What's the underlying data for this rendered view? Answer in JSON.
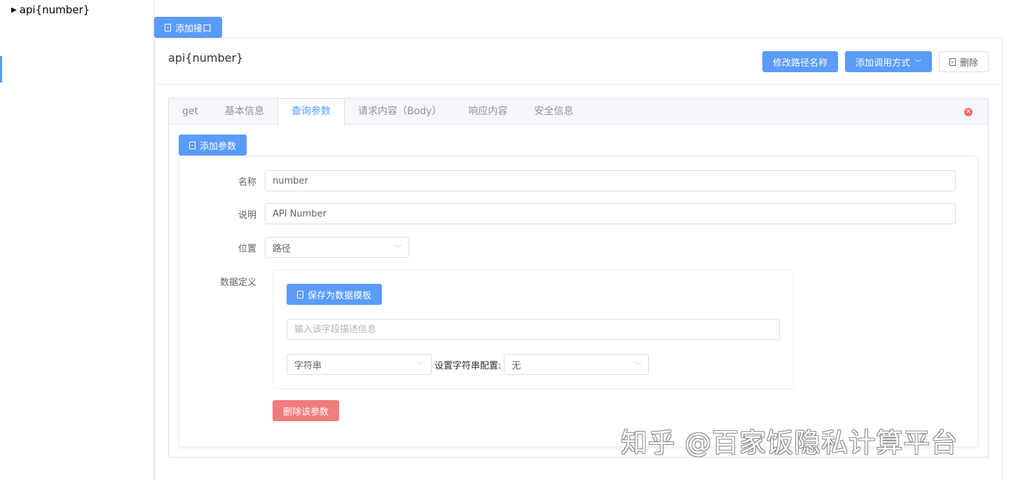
{
  "tree": {
    "node_label": "api{number}"
  },
  "toolbar": {
    "add_api_label": "添加接口"
  },
  "panel": {
    "title": "api{number}",
    "rename_label": "修改路径名称",
    "add_method_label": "添加调用方式",
    "delete_label": "删除"
  },
  "tabs": [
    {
      "label": "get"
    },
    {
      "label": "基本信息"
    },
    {
      "label": "查询参数"
    },
    {
      "label": "请求内容（Body）"
    },
    {
      "label": "响应内容"
    },
    {
      "label": "安全信息"
    }
  ],
  "active_tab": "查询参数",
  "params": {
    "add_label": "添加参数",
    "name_label": "名称",
    "name_value": "number",
    "desc_label": "说明",
    "desc_value": "API Number",
    "position_label": "位置",
    "position_value": "路径",
    "data_def_label": "数据定义",
    "save_template_label": "保存为数据模板",
    "field_desc_placeholder": "输入该字段描述信息",
    "type_value": "字符串",
    "string_config_label": "设置字符串配置:",
    "string_config_value": "无",
    "delete_param_label": "删除该参数"
  },
  "watermark": "知乎 @百家饭隐私计算平台",
  "colors": {
    "primary": "#5a9cf8",
    "danger": "#f07c7c"
  }
}
